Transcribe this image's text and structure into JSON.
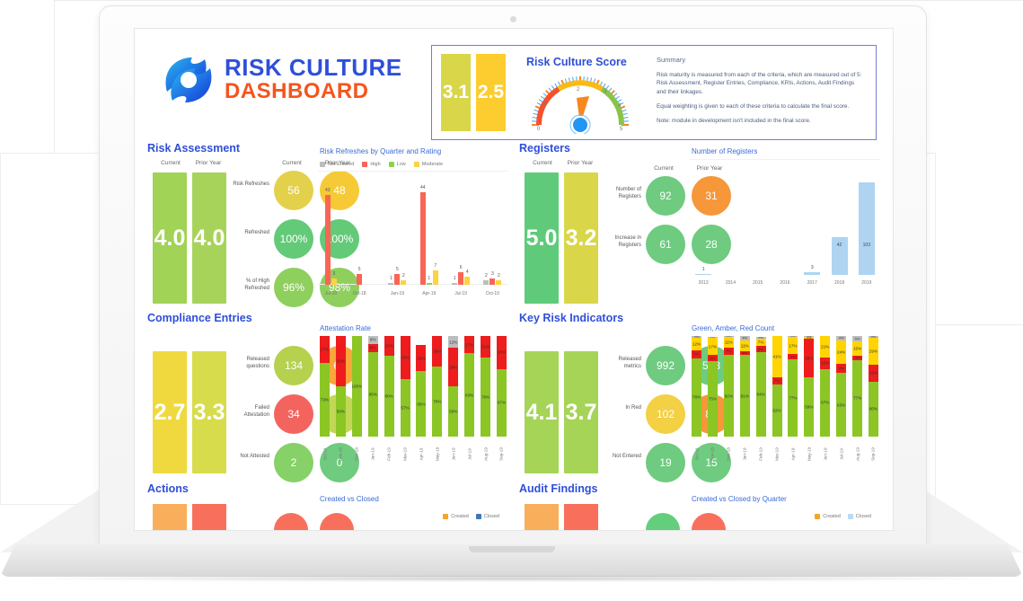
{
  "brand": {
    "line1": "RISK CULTURE",
    "line2": "DASHBOARD",
    "logo_icon": "swirl-logo-icon"
  },
  "score_panel": {
    "title": "Risk Culture Score",
    "current": "3.1",
    "prior": "2.5",
    "gauge_value": 3.0,
    "gauge_min": 0,
    "gauge_max": 5,
    "summary_heading": "Summary",
    "summary_paragraphs": [
      "Risk maturity is measured from each of the criteria, which are measured out of 5: Risk Assessment, Register Entries, Compliance, KRIs, Actions, Audit Findings and their linkages.",
      "Equal weighting is given to each of these criteria to calculate the final score.",
      "Note: module in development isn't included in the final score."
    ]
  },
  "col_headers": {
    "current": "Current",
    "prior": "Prior Year"
  },
  "sections": {
    "risk_assessment": {
      "title": "Risk Assessment",
      "score_current": "4.0",
      "score_prior": "4.0",
      "score_current_color": "#a0d356",
      "score_prior_color": "#a8d35a",
      "metrics": [
        {
          "label": "Risk Refreshes",
          "current": "56",
          "prior": "48",
          "current_color": "#e3d14c",
          "prior_color": "#f6ca36"
        },
        {
          "label": "Refreshed",
          "current": "100%",
          "prior": "100%",
          "current_color": "#63ca78",
          "prior_color": "#63ca78"
        },
        {
          "label": "% of High Refreshed",
          "current": "96%",
          "prior": "98%",
          "current_color": "#8ecf5e",
          "prior_color": "#8ecf5e"
        }
      ]
    },
    "registers": {
      "title": "Registers",
      "score_current": "5.0",
      "score_prior": "3.2",
      "score_current_color": "#5fcb7a",
      "score_prior_color": "#d9d64a",
      "metrics": [
        {
          "label": "Number of Registers",
          "current": "92",
          "prior": "31",
          "current_color": "#6ecb7f",
          "prior_color": "#f6973a"
        },
        {
          "label": "Increase in Registers",
          "current": "61",
          "prior": "28",
          "current_color": "#6ecb7f",
          "prior_color": "#6ecb7f"
        }
      ]
    },
    "compliance": {
      "title": "Compliance Entries",
      "score_current": "2.7",
      "score_prior": "3.3",
      "score_current_color": "#f0d93f",
      "score_prior_color": "#d7dc4c",
      "metrics": [
        {
          "label": "Released questions",
          "current": "134",
          "prior": "61",
          "current_color": "#b5d14e",
          "prior_color": "#f9a council"
        },
        {
          "label": "Failed Attestation",
          "current": "34",
          "prior": "4",
          "current_color": "#f4645e",
          "prior_color": "#c3d757"
        },
        {
          "label": "Not Attested",
          "current": "2",
          "prior": "0",
          "current_color": "#86d168",
          "prior_color": "#6ecb7f"
        }
      ]
    },
    "kri": {
      "title": "Key Risk Indicators",
      "score_current": "4.1",
      "score_prior": "3.7",
      "score_current_color": "#a5d457",
      "score_prior_color": "#a5d457",
      "metrics": [
        {
          "label": "Released metrics",
          "current": "992",
          "prior": "588",
          "current_color": "#6ecb7f",
          "prior_color": "#6ecb7f"
        },
        {
          "label": "In Red",
          "current": "102",
          "prior": "85",
          "current_color": "#f3d044",
          "prior_color": "#f6973a"
        },
        {
          "label": "Not Entered",
          "current": "19",
          "prior": "15",
          "current_color": "#6ecb7f",
          "prior_color": "#6ecb7f"
        }
      ]
    },
    "actions": {
      "title": "Actions",
      "chart_title": "Created vs Closed",
      "legend": [
        "Created",
        "Closed"
      ],
      "legend_colors": [
        "#f5a623",
        "#3d78b5"
      ]
    },
    "audit_findings": {
      "title": "Audit Findings",
      "chart_title": "Created vs Closed by Quarter",
      "legend": [
        "Created",
        "Closed"
      ],
      "legend_colors": [
        "#f5a623",
        "#bcd9f2"
      ]
    }
  },
  "chart_data": [
    {
      "type": "bar",
      "id": "risk-refreshes",
      "title": "Risk Refreshes by Quarter and Rating",
      "categories": [
        "Jul-18",
        "Oct-18",
        "Jan-19",
        "Apr-19",
        "Jul-19",
        "Oct-19"
      ],
      "legend": [
        "Not Entered",
        "High",
        "Low",
        "Moderate"
      ],
      "legend_colors": [
        "#bdbdbd",
        "#fa6455",
        "#8bd44a",
        "#ffd23f"
      ],
      "series": [
        {
          "name": "Not Entered",
          "color": "#bdbdbd",
          "values": [
            0,
            0,
            1,
            0,
            1,
            2
          ]
        },
        {
          "name": "High",
          "color": "#fa6455",
          "values": [
            43,
            5,
            5,
            44,
            6,
            3
          ]
        },
        {
          "name": "Low",
          "color": "#8bd44a",
          "values": [
            0,
            0,
            0,
            1,
            0,
            0
          ]
        },
        {
          "name": "Moderate",
          "color": "#ffd23f",
          "values": [
            3,
            0,
            2,
            7,
            4,
            2
          ]
        }
      ],
      "ylim": [
        0,
        48
      ],
      "grid": false,
      "legend_position": "top"
    },
    {
      "type": "bar",
      "id": "number-of-registers",
      "title": "Number of Registers",
      "categories": [
        "2013",
        "2014",
        "2015",
        "2016",
        "2017",
        "2018",
        "2019"
      ],
      "values": [
        1,
        0,
        0,
        0,
        3,
        42,
        103
      ],
      "color": "#aed4f2",
      "ylim": [
        0,
        110
      ],
      "grid": false
    },
    {
      "type": "bar",
      "id": "attestation-rate",
      "title": "Attestation Rate",
      "stacked": true,
      "categories": [
        "Oct-18",
        "Nov-18",
        "Dec-18",
        "Jan-19",
        "Feb-19",
        "Mar-19",
        "Apr-19",
        "May-19",
        "Jun-19",
        "Jul-19",
        "Aug-19",
        "Sep-19"
      ],
      "series": [
        {
          "name": "Not Entered",
          "color": "#bdbdbd",
          "values": [
            0,
            0,
            0,
            8,
            0,
            0,
            0,
            0,
            12,
            0,
            0,
            0
          ]
        },
        {
          "name": "Failed",
          "color": "#ee1c1c",
          "values": [
            27,
            50,
            0,
            8,
            20,
            43,
            26,
            30,
            38,
            17,
            21,
            33
          ]
        },
        {
          "name": "Attested",
          "color": "#8bc624",
          "values": [
            73,
            50,
            100,
            85,
            80,
            57,
            65,
            70,
            50,
            83,
            79,
            67
          ]
        }
      ],
      "ylim": [
        0,
        100
      ],
      "unit": "%"
    },
    {
      "type": "bar",
      "id": "green-amber-red-count",
      "title": "Green, Amber, Red Count",
      "stacked": true,
      "categories": [
        "Oct-18",
        "Nov-18",
        "Dec-18",
        "Jan-19",
        "Feb-19",
        "Mar-19",
        "Apr-19",
        "May-19",
        "Jun-19",
        "Jul-19",
        "Aug-19",
        "Sep-19"
      ],
      "series": [
        {
          "name": "Green",
          "color": "#8bc624",
          "values": [
            78,
            75,
            82,
            81,
            84,
            52,
            77,
            59,
            67,
            63,
            77,
            60
          ]
        },
        {
          "name": "Red",
          "color": "#ee1c1c",
          "values": [
            8,
            6,
            7,
            4,
            6,
            7,
            5,
            38,
            12,
            9,
            4,
            19
          ]
        },
        {
          "name": "Amber",
          "color": "#ffd400",
          "values": [
            12,
            17,
            11,
            11,
            7,
            41,
            17,
            2,
            21,
            24,
            15,
            29
          ]
        },
        {
          "name": "Not Entered",
          "color": "#bdbdbd",
          "values": [
            2,
            1,
            1,
            4,
            2,
            0,
            1,
            1,
            0,
            4,
            5,
            2
          ]
        }
      ],
      "ylim": [
        0,
        100
      ],
      "unit": "%"
    }
  ]
}
